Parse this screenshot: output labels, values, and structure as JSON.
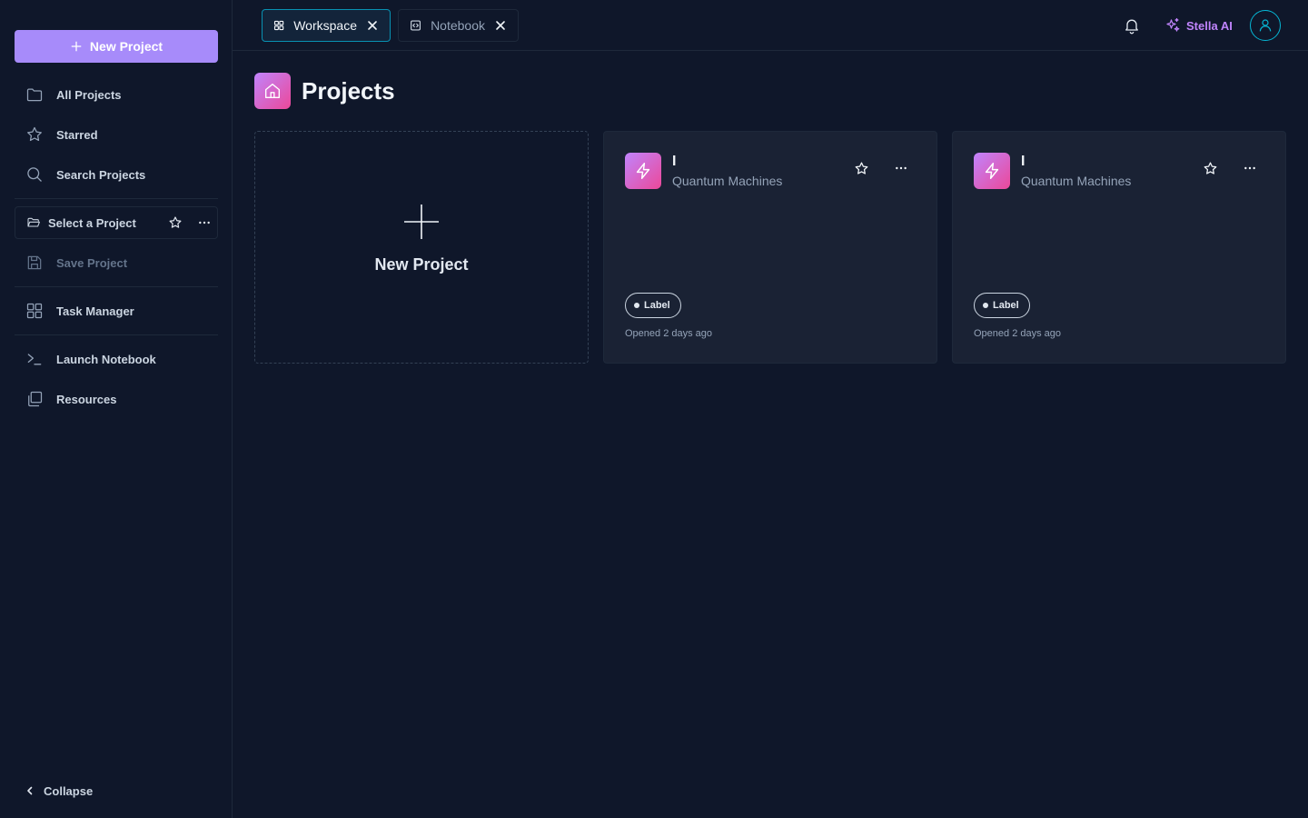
{
  "colors": {
    "background": "#0f172a",
    "accent_button": "#a78bfa",
    "active_tab_border": "#0891b2",
    "stella_ai": "#c084fc",
    "card_bg": "#1a2234",
    "icon_gradient": [
      "#c084fc",
      "#ec4899"
    ]
  },
  "sidebar": {
    "new_project_label": "New Project",
    "items": [
      {
        "label": "All Projects",
        "icon": "folder-icon"
      },
      {
        "label": "Starred",
        "icon": "star-icon"
      },
      {
        "label": "Search Projects",
        "icon": "search-icon"
      }
    ],
    "select_project": {
      "label": "Select a Project",
      "icon": "folder-open-icon"
    },
    "save_project": {
      "label": "Save Project",
      "icon": "save-icon"
    },
    "task_manager": {
      "label": "Task Manager",
      "icon": "grid-icon"
    },
    "launch_notebook": {
      "label": "Launch Notebook",
      "icon": "terminal-icon"
    },
    "resources": {
      "label": "Resources",
      "icon": "stack-icon"
    },
    "collapse_label": "Collapse"
  },
  "topbar": {
    "tabs": [
      {
        "label": "Workspace",
        "icon": "grid-icon",
        "active": true
      },
      {
        "label": "Notebook",
        "icon": "code-icon",
        "active": false
      }
    ],
    "assistant_label": "Stella AI"
  },
  "main": {
    "title": "Projects",
    "new_card_label": "New Project",
    "projects": [
      {
        "title": "I",
        "subtitle": "Quantum Machines",
        "label": "Label",
        "opened": "Opened 2 days ago"
      },
      {
        "title": "I",
        "subtitle": "Quantum Machines",
        "label": "Label",
        "opened": "Opened 2 days ago"
      }
    ]
  }
}
